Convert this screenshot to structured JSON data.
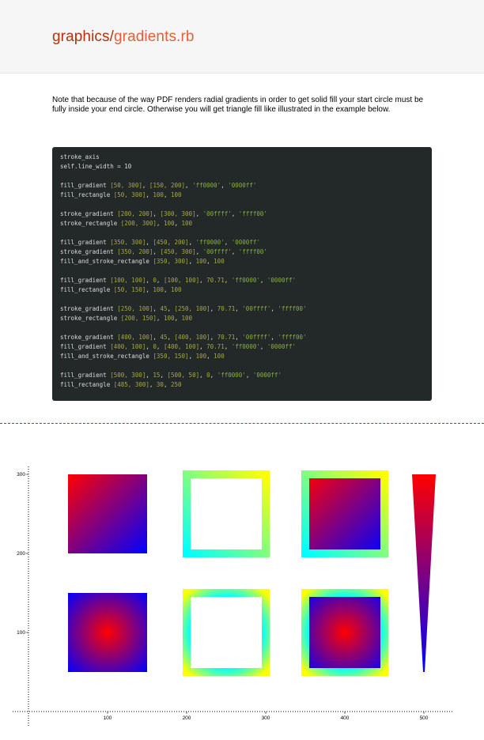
{
  "header": {
    "folder": "graphics/",
    "file": "gradients.rb"
  },
  "intro": "Note that because of the way PDF renders radial gradients in order to get solid fill your start circle must be fully inside your end circle. Otherwise you will get triangle fill like illustrated in the example below.",
  "code_lines": [
    "stroke_axis",
    "self.line_width = 10",
    "",
    "fill_gradient [50, 300], [150, 200], 'ff0000', '0000ff'",
    "fill_rectangle [50, 300], 100, 100",
    "",
    "stroke_gradient [200, 200], [300, 300], '00ffff', 'ffff00'",
    "stroke_rectangle [200, 300], 100, 100",
    "",
    "fill_gradient [350, 300], [450, 200], 'ff0000', '0000ff'",
    "stroke_gradient [350, 200], [450, 300], '00ffff', 'ffff00'",
    "fill_and_stroke_rectangle [350, 300], 100, 100",
    "",
    "fill_gradient [100, 100], 0, [100, 100], 70.71, 'ff0000', '0000ff'",
    "fill_rectangle [50, 150], 100, 100",
    "",
    "stroke_gradient [250, 100], 45, [250, 100], 70.71, '00ffff', 'ffff00'",
    "stroke_rectangle [200, 150], 100, 100",
    "",
    "stroke_gradient [400, 100], 45, [400, 100], 70.71, '00ffff', 'ffff00'",
    "fill_gradient [400, 100], 0, [400, 100], 70.71, 'ff0000', '0000ff'",
    "fill_and_stroke_rectangle [350, 150], 100, 100",
    "",
    "fill_gradient [500, 300], 15, [500, 50], 0, 'ff0000', '0000ff'",
    "fill_rectangle [485, 300], 30, 250"
  ],
  "axis": {
    "x_ticks": [
      "100",
      "200",
      "300",
      "400",
      "500"
    ],
    "y_ticks": [
      "100",
      "200",
      "300"
    ]
  },
  "colors": {
    "red": "#ff0000",
    "blue": "#0000ff",
    "cyan": "#00ffff",
    "yellow": "#ffff00",
    "title_folder": "#b5300b",
    "title_file": "#e35f3b",
    "code_background": "#232829",
    "code_number": "#a8a840",
    "code_string": "#86b043"
  }
}
